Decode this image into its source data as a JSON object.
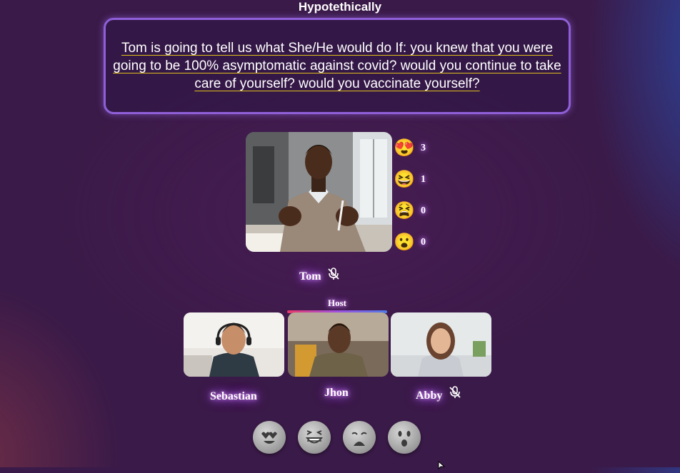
{
  "header": {
    "title": "Hypotethically"
  },
  "question": {
    "text": "Tom is going to tell us what She/He would do If: you knew that you were going to be 100% asymptomatic against covid? would you continue to take care of yourself? would you vaccinate yourself?"
  },
  "reactions": [
    {
      "emoji": "😍",
      "icon": "heart-eyes-icon",
      "count": "3"
    },
    {
      "emoji": "😆",
      "icon": "laughing-icon",
      "count": "1"
    },
    {
      "emoji": "😫",
      "icon": "crying-icon",
      "count": "0"
    },
    {
      "emoji": "😮",
      "icon": "surprised-icon",
      "count": "0"
    }
  ],
  "speaker": {
    "name": "Tom",
    "mic": "muted"
  },
  "participants": [
    {
      "name": "Sebastian",
      "mic": "on"
    },
    {
      "name": "Jhon",
      "role": "Host",
      "mic": "on"
    },
    {
      "name": "Abby",
      "mic": "muted"
    }
  ],
  "reaction_buttons": [
    {
      "icon": "heart-eyes-icon"
    },
    {
      "icon": "laughing-icon"
    },
    {
      "icon": "weary-icon"
    },
    {
      "icon": "surprised-icon"
    }
  ],
  "colors": {
    "background": "#3a1a48",
    "accent": "#8f5fd8",
    "underline": "#e2c21a",
    "glow": "#b060ff"
  }
}
